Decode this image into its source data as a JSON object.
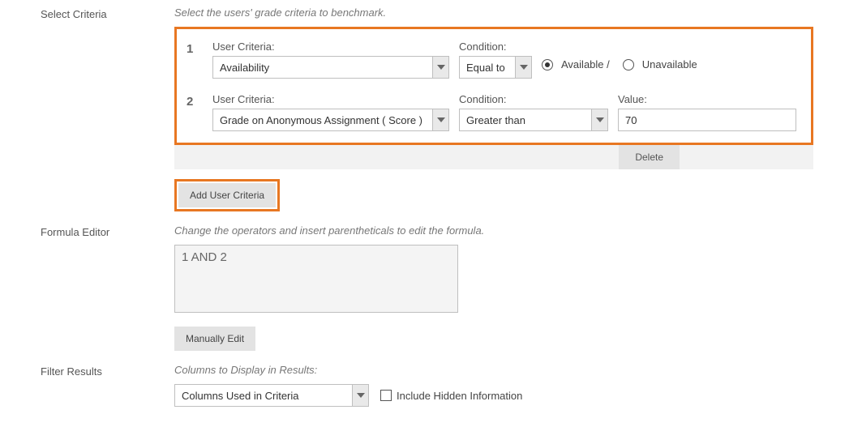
{
  "sections": {
    "select_criteria": {
      "label": "Select Criteria",
      "hint": "Select the users' grade criteria to benchmark."
    },
    "formula_editor": {
      "label": "Formula Editor",
      "hint": "Change the operators and insert parentheticals to edit the formula."
    },
    "filter_results": {
      "label": "Filter Results",
      "hint": "Columns to Display in Results:"
    }
  },
  "criteria": [
    {
      "num": "1",
      "user_criteria_label": "User Criteria:",
      "user_criteria_value": "Availability",
      "condition_label": "Condition:",
      "condition_value": "Equal to",
      "radio_available": "Available /",
      "radio_unavailable": "Unavailable"
    },
    {
      "num": "2",
      "user_criteria_label": "User Criteria:",
      "user_criteria_value": "Grade on Anonymous Assignment ( Score )",
      "condition_label": "Condition:",
      "condition_value": "Greater than",
      "value_label": "Value:",
      "value": "70"
    }
  ],
  "buttons": {
    "delete": "Delete",
    "add_user_criteria": "Add User Criteria",
    "manually_edit": "Manually Edit"
  },
  "formula": {
    "value": "1 AND 2"
  },
  "filter": {
    "select_value": "Columns Used in Criteria",
    "checkbox_label": "Include Hidden Information"
  }
}
